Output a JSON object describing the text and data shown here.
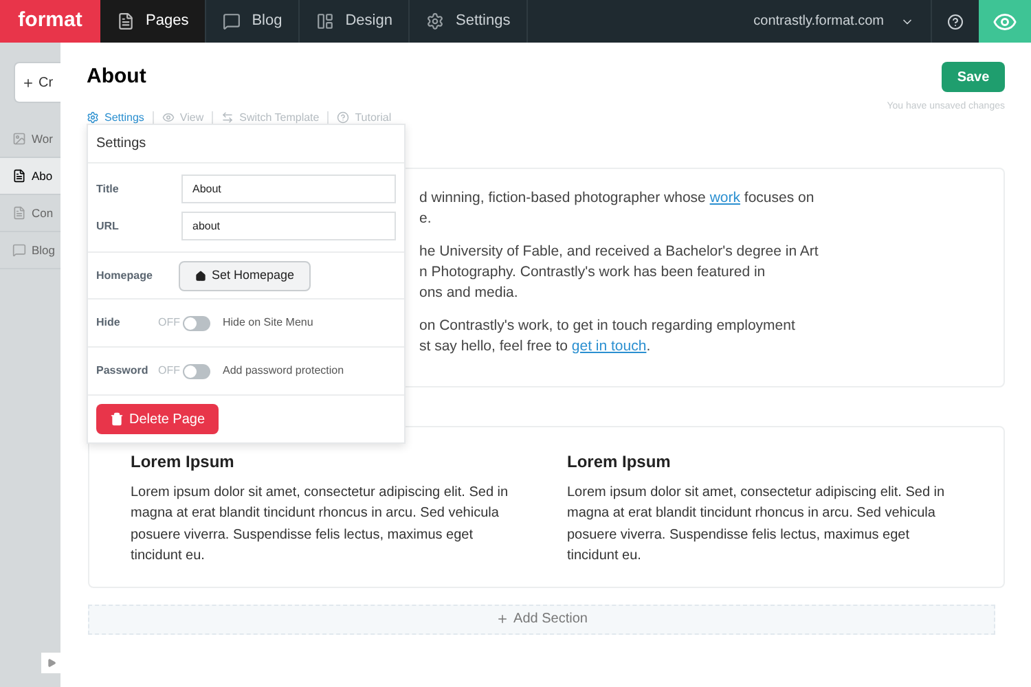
{
  "brand": "format",
  "nav": [
    {
      "label": "Pages",
      "selected": true
    },
    {
      "label": "Blog",
      "selected": false
    },
    {
      "label": "Design",
      "selected": false
    },
    {
      "label": "Settings",
      "selected": false
    }
  ],
  "site": "contrastly.format.com",
  "sidebar": {
    "create_label": "Cr",
    "items": [
      {
        "label": "Wor",
        "selected": false
      },
      {
        "label": "Abo",
        "selected": true
      },
      {
        "label": "Con",
        "selected": false
      },
      {
        "label": "Blog",
        "selected": false
      }
    ]
  },
  "page": {
    "title": "About",
    "save": "Save",
    "status": "You have unsaved changes",
    "tabs": [
      {
        "label": "Settings",
        "selected": true
      },
      {
        "label": "View",
        "selected": false
      },
      {
        "label": "Switch Template",
        "selected": false
      },
      {
        "label": "Tutorial",
        "selected": false
      }
    ]
  },
  "settings_panel": {
    "title": "Settings",
    "fields": [
      {
        "label": "Title",
        "value": "About"
      },
      {
        "label": "URL",
        "value": "about"
      }
    ],
    "homepage": {
      "label": "Homepage",
      "button": "Set Homepage"
    },
    "toggles": [
      {
        "label": "Hide",
        "state": "OFF",
        "on": false,
        "text": "Hide on Site Menu"
      },
      {
        "label": "Password",
        "state": "OFF",
        "on": false,
        "text": "Add password protection"
      }
    ],
    "delete": "Delete Page"
  },
  "intro_paragraphs": [
    [
      [
        {
          "text": "d winning, fiction-based photographer whose "
        },
        {
          "text": "work",
          "link": true
        },
        {
          "text": " focuses on"
        }
      ],
      [
        {
          "text": "e."
        }
      ]
    ],
    [
      [
        {
          "text": "he University of Fable, and received a Bachelor's degree in Art"
        }
      ],
      [
        {
          "text": "n Photography. Contrastly's work has been featured in"
        }
      ],
      [
        {
          "text": "ons and media."
        }
      ]
    ],
    [
      [
        {
          "text": "on Contrastly's work, to get in touch regarding employment"
        }
      ],
      [
        {
          "text": "st say hello, feel free to "
        },
        {
          "text": "get in touch",
          "link": true
        },
        {
          "text": "."
        }
      ]
    ]
  ],
  "columns": [
    {
      "heading": "Lorem Ipsum",
      "body": "Lorem ipsum dolor sit amet, consectetur adipiscing elit. Sed in magna at erat blandit tincidunt rhoncus in arcu. Sed vehicula posuere viverra. Suspendisse felis lectus, maximus eget tincidunt eu."
    },
    {
      "heading": "Lorem Ipsum",
      "body": "Lorem ipsum dolor sit amet, consectetur adipiscing elit. Sed in magna at erat blandit tincidunt rhoncus in arcu. Sed vehicula posuere viverra. Suspendisse felis lectus, maximus eget tincidunt eu."
    }
  ],
  "add_section": "Add Section"
}
